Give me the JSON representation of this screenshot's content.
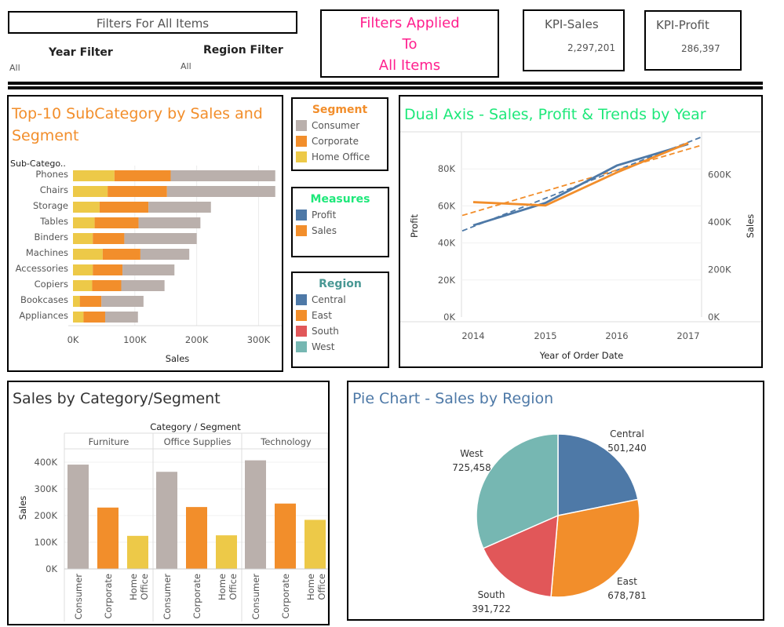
{
  "filters": {
    "header": "Filters For All Items",
    "year_label": "Year Filter",
    "year_value": "All",
    "region_label": "Region Filter",
    "region_value": "All",
    "applied_line1": "Filters Applied",
    "applied_line2": "To",
    "applied_line3": "All Items",
    "applied_color": "#ff1f8e"
  },
  "kpis": {
    "sales_label": "KPI-Sales",
    "sales_value": "2,297,201",
    "profit_label": "KPI-Profit",
    "profit_value": "286,397"
  },
  "colors": {
    "consumer": "#bab0ac",
    "corporate": "#f28e2b",
    "home_office": "#edc948",
    "profit": "#4e79a7",
    "sales": "#f28e2b",
    "central": "#4e79a7",
    "east": "#f28e2b",
    "south": "#e15759",
    "west": "#76b7b2",
    "title_orange": "#f28e2b",
    "title_green": "#1ee87a",
    "title_teal": "#499894",
    "title_blue": "#4e79a7"
  },
  "legends": {
    "segment": {
      "title": "Segment",
      "items": [
        "Consumer",
        "Corporate",
        "Home Office"
      ]
    },
    "measures": {
      "title": "Measures",
      "items": [
        "Profit",
        "Sales"
      ]
    },
    "region": {
      "title": "Region",
      "items": [
        "Central",
        "East",
        "South",
        "West"
      ]
    }
  },
  "chart_data": [
    {
      "type": "bar",
      "orientation": "horizontal-stacked",
      "title": "Top-10 SubCategory by Sales and Segment",
      "row_header": "Sub-Catego..",
      "xlabel": "Sales",
      "xlim": [
        0,
        340000
      ],
      "xticks": [
        "0K",
        "100K",
        "200K",
        "300K"
      ],
      "xtick_values": [
        0,
        100000,
        200000,
        300000
      ],
      "categories": [
        "Phones",
        "Chairs",
        "Storage",
        "Tables",
        "Binders",
        "Machines",
        "Accessories",
        "Copiers",
        "Bookcases",
        "Appliances"
      ],
      "series": [
        {
          "name": "Home Office",
          "values": [
            67000,
            56000,
            43000,
            35000,
            32000,
            48000,
            32000,
            31000,
            11000,
            17000
          ]
        },
        {
          "name": "Corporate",
          "values": [
            91000,
            96000,
            79000,
            71000,
            51000,
            61000,
            48000,
            47000,
            35000,
            35000
          ]
        },
        {
          "name": "Consumer",
          "values": [
            169000,
            175000,
            101000,
            100000,
            117000,
            79000,
            84000,
            70000,
            68000,
            53000
          ]
        }
      ]
    },
    {
      "type": "line",
      "title": "Dual Axis - Sales, Profit & Trends by Year",
      "xlabel": "Year of Order Date",
      "ylabel_left": "Profit",
      "ylabel_right": "Sales",
      "x": [
        "2014",
        "2015",
        "2016",
        "2017"
      ],
      "ylim_left": [
        0,
        100000
      ],
      "yticks_left": [
        "0K",
        "20K",
        "40K",
        "60K",
        "80K"
      ],
      "ytick_values_left": [
        0,
        20000,
        40000,
        60000,
        80000
      ],
      "ylim_right": [
        0,
        780000
      ],
      "yticks_right": [
        "0K",
        "200K",
        "400K",
        "600K"
      ],
      "ytick_values_right": [
        0,
        200000,
        400000,
        600000
      ],
      "series": [
        {
          "name": "Profit",
          "axis": "left",
          "values": [
            49500,
            61600,
            81800,
            93400
          ]
        },
        {
          "name": "Sales",
          "axis": "right",
          "values": [
            484000,
            470000,
            609000,
            733000
          ]
        }
      ],
      "trend_lines": true
    },
    {
      "type": "bar",
      "title": "Sales by Category/Segment",
      "header": "Category / Segment",
      "ylabel": "Sales",
      "ylim": [
        0,
        450000
      ],
      "yticks": [
        "0K",
        "100K",
        "200K",
        "300K",
        "400K"
      ],
      "ytick_values": [
        0,
        100000,
        200000,
        300000,
        400000
      ],
      "categories": [
        "Furniture",
        "Office Supplies",
        "Technology"
      ],
      "segments": [
        "Consumer",
        "Corporate",
        "Home Office"
      ],
      "values": [
        [
          391000,
          230000,
          124000
        ],
        [
          364000,
          232000,
          126000
        ],
        [
          407000,
          245000,
          184000
        ]
      ]
    },
    {
      "type": "pie",
      "title": "Pie Chart - Sales by Region",
      "labels": [
        "Central",
        "East",
        "South",
        "West"
      ],
      "values": [
        501240,
        678781,
        391722,
        725458
      ],
      "value_labels": [
        "501,240",
        "678,781",
        "391,722",
        "725,458"
      ]
    }
  ]
}
